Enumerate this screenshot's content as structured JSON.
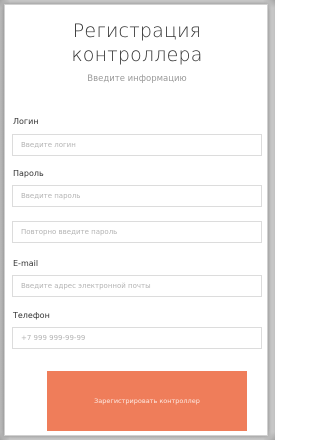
{
  "form": {
    "title_line1": "Регистрация",
    "title_line2": "контроллера",
    "subtitle": "Введите информацию",
    "fields": {
      "login": {
        "label": "Логин",
        "placeholder": "Введите логин",
        "value": ""
      },
      "password": {
        "label": "Пароль",
        "placeholder": "Введите пароль",
        "value": ""
      },
      "password_repeat": {
        "placeholder": "Повторно введите пароль",
        "value": ""
      },
      "email": {
        "label": "E-mail",
        "placeholder": "Введите адрес электронной почты",
        "value": ""
      },
      "phone": {
        "label": "Телефон",
        "placeholder": "+7 999 999-99-99",
        "value": ""
      }
    },
    "submit_label": "Зарегистрировать контроллер"
  },
  "colors": {
    "accent": "#ef7d5a",
    "text": "#333333",
    "muted": "#9a9a9a",
    "border": "#dcdcdc"
  }
}
